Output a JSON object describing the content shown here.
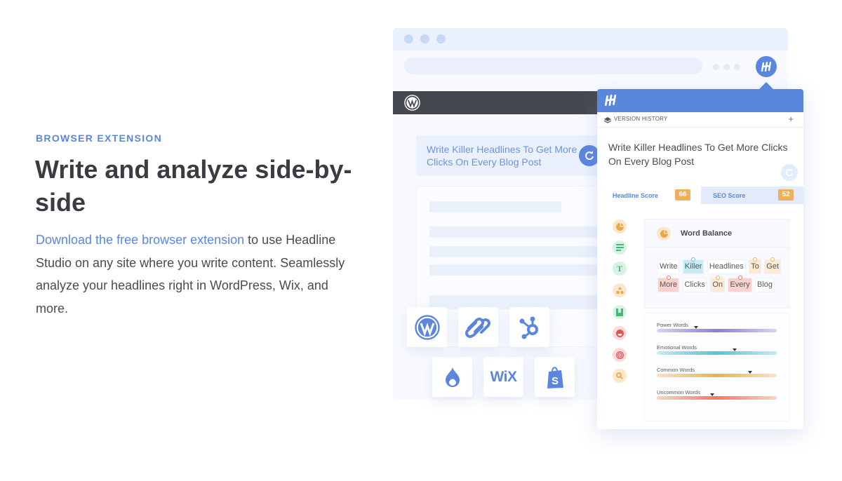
{
  "hero": {
    "eyebrow": "BROWSER EXTENSION",
    "title": "Write and analyze side-by-side",
    "description_link": "Download the free browser extension",
    "description_rest": " to use Headline Studio on any site where you write content. Seamlessly analyze your headlines right in WordPress, Wix, and more.",
    "colors": {
      "accent": "#5b86dd",
      "heading": "#3b3c42",
      "body": "#4a4b52"
    }
  },
  "browser_mock": {
    "editor_headline": "Write Killer Headlines To Get More Clicks On Every Blog Post",
    "platforms": [
      {
        "name": "WordPress",
        "icon": "wordpress-icon"
      },
      {
        "name": "Squarespace",
        "icon": "squarespace-icon"
      },
      {
        "name": "HubSpot",
        "icon": "hubspot-icon"
      },
      {
        "name": "Drupal",
        "icon": "drupal-icon"
      },
      {
        "name": "Wix",
        "icon": "wix-icon",
        "text": "WiX"
      },
      {
        "name": "Shopify",
        "icon": "shopify-icon"
      }
    ]
  },
  "extension_panel": {
    "version_history_label": "VERSION HISTORY",
    "add_label": "+",
    "headline": "Write Killer Headlines To Get More Clicks On Every Blog Post",
    "tabs": [
      {
        "label": "Headline Score",
        "score": "66",
        "active": true
      },
      {
        "label": "SEO Score",
        "score": "52",
        "active": false
      }
    ],
    "side_icons": [
      "word-balance-icon",
      "length-icon",
      "type-icon",
      "shapes-icon",
      "bookmark-icon",
      "emotion-icon",
      "target-icon",
      "search-icon"
    ],
    "word_balance": {
      "title": "Word Balance",
      "words": [
        {
          "text": "Write",
          "type": "none"
        },
        {
          "text": "Killer",
          "type": "blue"
        },
        {
          "text": "Headlines",
          "type": "none"
        },
        {
          "text": "To",
          "type": "orange"
        },
        {
          "text": "Get",
          "type": "orange"
        },
        {
          "text": "More",
          "type": "red"
        },
        {
          "text": "Clicks",
          "type": "none"
        },
        {
          "text": "On",
          "type": "orange"
        },
        {
          "text": "Every",
          "type": "red"
        },
        {
          "text": "Blog",
          "type": "none"
        }
      ]
    },
    "meters": [
      {
        "label": "Power Words",
        "value": 0.33,
        "color": "#8b7fd6"
      },
      {
        "label": "Emotional Words",
        "value": 0.65,
        "color": "#55c3d9"
      },
      {
        "label": "Common Words",
        "value": 0.78,
        "color": "#eeb04f"
      },
      {
        "label": "Uncommon Words",
        "value": 0.46,
        "color": "#f27a5e"
      }
    ]
  }
}
